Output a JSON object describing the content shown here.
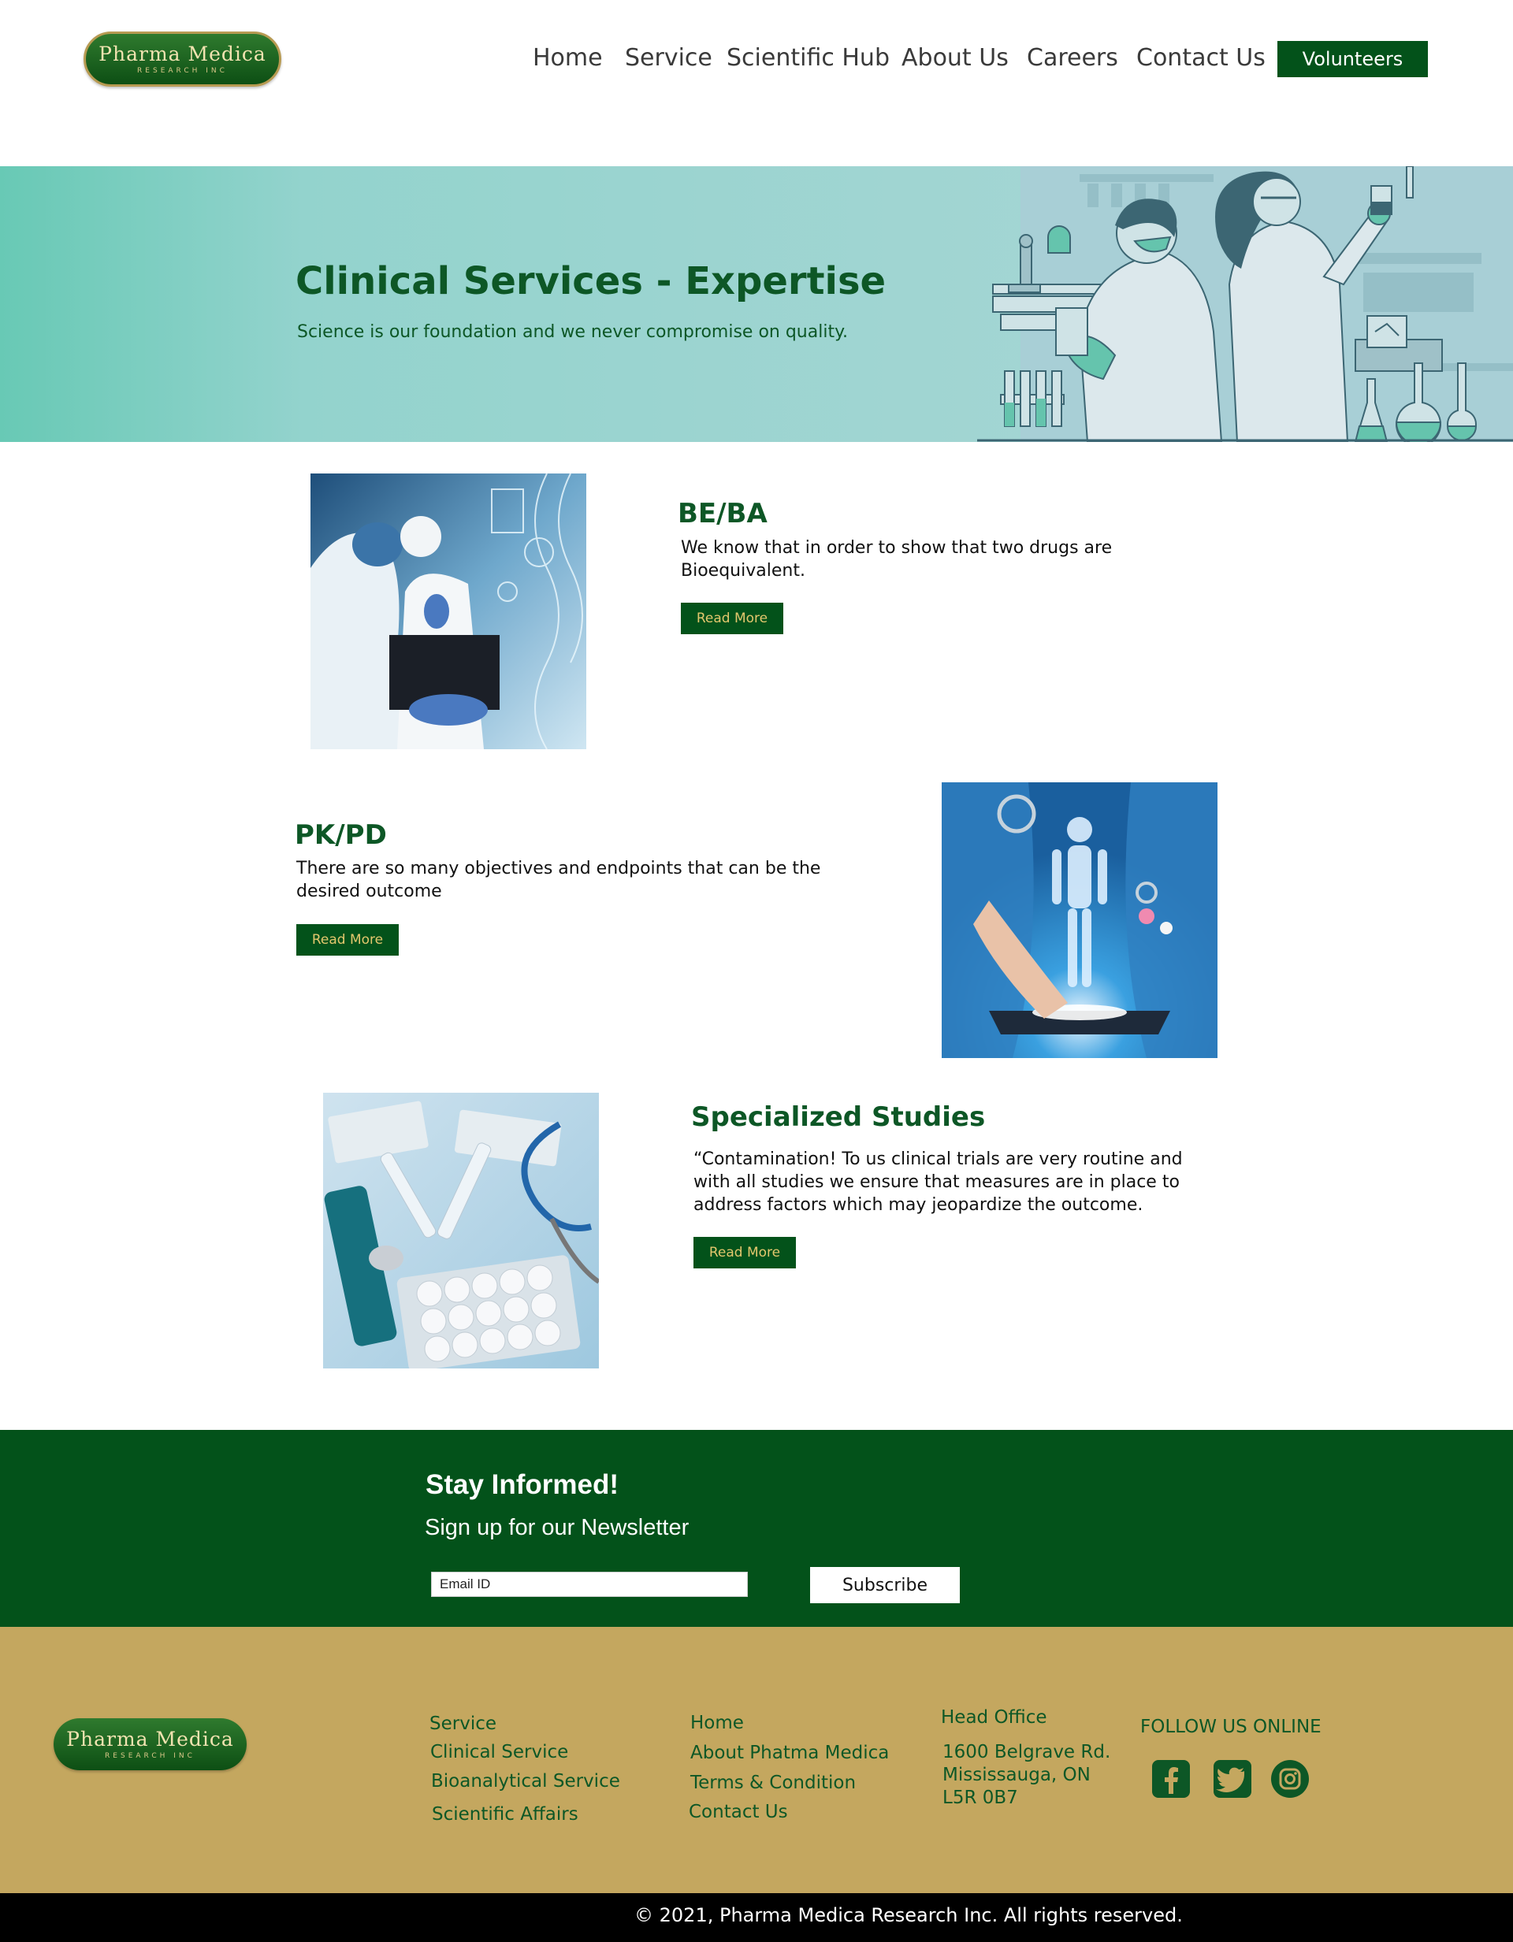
{
  "header": {
    "logo": {
      "line1": "Pharma Medica",
      "line2": "RESEARCH INC"
    },
    "nav": [
      {
        "label": "Home"
      },
      {
        "label": "Service"
      },
      {
        "label": "Scientific Hub"
      },
      {
        "label": "About Us"
      },
      {
        "label": "Careers"
      },
      {
        "label": "Contact Us"
      }
    ],
    "cta_label": "Volunteers"
  },
  "hero": {
    "title": "Clinical Services - Expertise",
    "subtitle": "Science is our foundation and we never compromise on quality."
  },
  "services": [
    {
      "title": "BE/BA",
      "description": "We know that in order to show that two drugs are Bioequivalent.",
      "button": "Read More"
    },
    {
      "title": "PK/PD",
      "description": "There are so many objectives and endpoints that can be the desired outcome",
      "button": "Read More"
    },
    {
      "title": "Specialized Studies",
      "description": "“Contamination! To us clinical trials are very routine and with all studies we ensure that measures are in place to address factors which may jeopardize the outcome.",
      "button": "Read More"
    }
  ],
  "newsletter": {
    "title": "Stay Informed!",
    "subtitle": "Sign up for our Newsletter",
    "email_placeholder": "Email ID",
    "button": "Subscribe"
  },
  "footer": {
    "logo": {
      "line1": "Pharma Medica",
      "line2": "RESEARCH INC"
    },
    "service_links": [
      "Service",
      "Clinical Service",
      "Bioanalytical Service",
      "Scientific Affairs"
    ],
    "site_links": [
      "Home",
      "About Phatma Medica",
      "Terms & Condition",
      "Contact Us"
    ],
    "office": {
      "heading": "Head Office",
      "address": [
        "1600 Belgrave Rd.",
        "Mississauga, ON",
        "L5R 0B7"
      ]
    },
    "follow_heading": "FOLLOW US ONLINE",
    "social": [
      {
        "icon": "facebook-icon"
      },
      {
        "icon": "twitter-icon"
      },
      {
        "icon": "instagram-icon"
      }
    ]
  },
  "copyright": "© 2021, Pharma Medica Research Inc. All rights reserved.",
  "colors": {
    "brand_green": "#03521a",
    "heading_green": "#0d5726",
    "hero_teal": "#a0d5d2",
    "footer_tan": "#c4a75f",
    "button_text_gold": "#e3c76d"
  }
}
